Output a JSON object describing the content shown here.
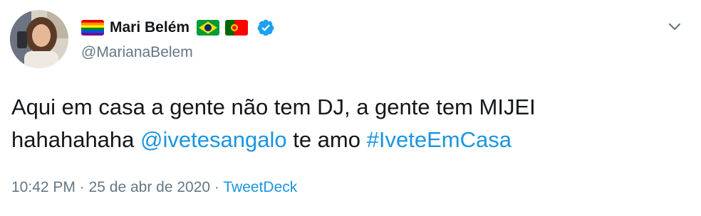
{
  "author": {
    "display_name": "Mari Belém",
    "handle": "@MarianaBelem",
    "name_emojis": [
      "rainbow-flag",
      "brazil-flag",
      "portugal-flag"
    ],
    "verified": true
  },
  "tweet": {
    "line1": "Aqui em casa a gente não tem DJ, a gente tem MIJEI",
    "line2_prefix": "hahahahaha",
    "mention": "@ivetesangalo",
    "middle": "te amo",
    "hashtag": "#IveteEmCasa"
  },
  "meta": {
    "time": "10:42 PM",
    "separator": "·",
    "date": "25 de abr de 2020",
    "source": "TweetDeck"
  },
  "colors": {
    "link": "#1b95e0",
    "secondary_text": "#657786",
    "primary_text": "#14171a",
    "verified_badge": "#1da1f2"
  }
}
